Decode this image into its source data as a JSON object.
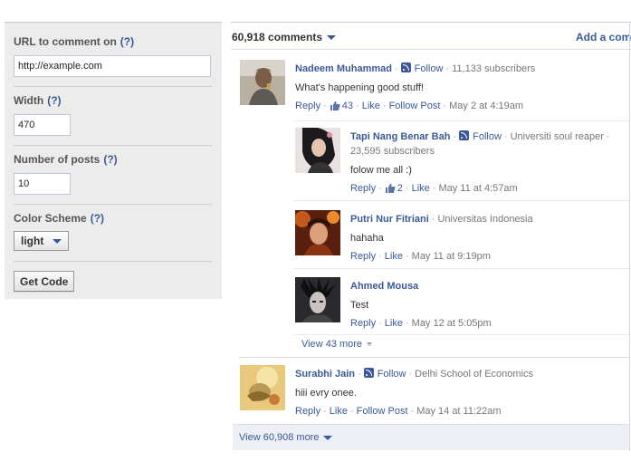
{
  "config": {
    "url": {
      "label": "URL to comment on",
      "help": "(?)",
      "value": "http://example.com"
    },
    "width": {
      "label": "Width",
      "help": "(?)",
      "value": "470"
    },
    "posts": {
      "label": "Number of posts",
      "help": "(?)",
      "value": "10"
    },
    "scheme": {
      "label": "Color Scheme",
      "help": "(?)",
      "selected": "light"
    },
    "get_code_label": "Get Code"
  },
  "comments": {
    "count_label": "60,918 comments",
    "add_label": "Add a comment",
    "view_more_label": "View 60,908 more",
    "posts": [
      {
        "author": "Nadeem Muhammad",
        "follow_label": "Follow",
        "detail": "11,133 subscribers",
        "text": "What's happening good stuff!",
        "actions": {
          "reply": "Reply",
          "like_count": "43",
          "like": "Like",
          "follow_post": "Follow Post",
          "time": "May 2 at 4:19am"
        },
        "replies": [
          {
            "author": "Tapi Nang Benar Bah",
            "follow_label": "Follow",
            "detail": "Universiti soul reaper",
            "detail2": "23,595 subscribers",
            "text": "folow me all :)",
            "actions": {
              "reply": "Reply",
              "like_count": "2",
              "like": "Like",
              "time": "May 11 at 4:57am"
            }
          },
          {
            "author": "Putri Nur Fitriani",
            "detail": "Universitas Indonesia",
            "text": "hahaha",
            "actions": {
              "reply": "Reply",
              "like": "Like",
              "time": "May 11 at 9:19pm"
            }
          },
          {
            "author": "Ahmed Mousa",
            "text": "Test",
            "actions": {
              "reply": "Reply",
              "like": "Like",
              "time": "May 12 at 5:05pm"
            }
          }
        ],
        "view_replies_label": "View 43 more"
      },
      {
        "author": "Surabhi Jain",
        "follow_label": "Follow",
        "detail": "Delhi School of Economics",
        "text": "hiii evry onee.",
        "actions": {
          "reply": "Reply",
          "like": "Like",
          "follow_post": "Follow Post",
          "time": "May 14 at 11:22am"
        }
      }
    ]
  },
  "colors": {
    "link": "#3b5998",
    "panel_bg": "#ececec",
    "bar_bg": "#edeff4"
  },
  "icons": [
    "help-icon",
    "dropdown-caret-icon",
    "rss-follow-icon",
    "thumbs-up-icon",
    "avatar-photo"
  ]
}
